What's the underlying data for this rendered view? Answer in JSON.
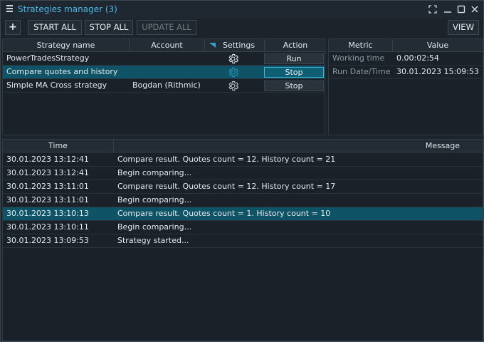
{
  "window": {
    "title": "Strategies manager (3)",
    "accent_color": "#4db8e8",
    "controls": [
      "expand-icon",
      "minimize-icon",
      "maximize-icon",
      "close-icon"
    ]
  },
  "toolbar": {
    "add_label": "+",
    "start_all_label": "START ALL",
    "stop_all_label": "STOP ALL",
    "update_all_label": "UPDATE ALL",
    "view_label": "VIEW"
  },
  "strategies": {
    "headers": {
      "name": "Strategy name",
      "account": "Account",
      "settings": "Settings",
      "action": "Action"
    },
    "rows": [
      {
        "name": "PowerTradesStrategy",
        "account": "",
        "action": "Run",
        "selected": false
      },
      {
        "name": "Compare quotes and history",
        "account": "",
        "action": "Stop",
        "selected": true
      },
      {
        "name": "Simple MA Cross strategy",
        "account": "Bogdan (Rithmic)",
        "action": "Stop",
        "selected": false
      }
    ]
  },
  "metrics": {
    "headers": {
      "metric": "Metric",
      "value": "Value"
    },
    "rows": [
      {
        "metric": "Working time",
        "value": "0.00:02:54"
      },
      {
        "metric": "Run Date/Time",
        "value": "30.01.2023 15:09:53"
      }
    ]
  },
  "log": {
    "headers": {
      "time": "Time",
      "message": "Message"
    },
    "selected_color": "#0e5466",
    "rows": [
      {
        "time": "30.01.2023 13:12:41",
        "message": "Compare result. Quotes count = 12. History count = 21",
        "selected": false
      },
      {
        "time": "30.01.2023 13:12:41",
        "message": "Begin comparing...",
        "selected": false
      },
      {
        "time": "30.01.2023 13:11:01",
        "message": "Compare result. Quotes count = 12. History count = 17",
        "selected": false
      },
      {
        "time": "30.01.2023 13:11:01",
        "message": "Begin comparing...",
        "selected": false
      },
      {
        "time": "30.01.2023 13:10:13",
        "message": "Compare result. Quotes count = 1. History count = 10",
        "selected": true
      },
      {
        "time": "30.01.2023 13:10:11",
        "message": "Begin comparing...",
        "selected": false
      },
      {
        "time": "30.01.2023 13:09:53",
        "message": "Strategy started...",
        "selected": false
      }
    ]
  }
}
